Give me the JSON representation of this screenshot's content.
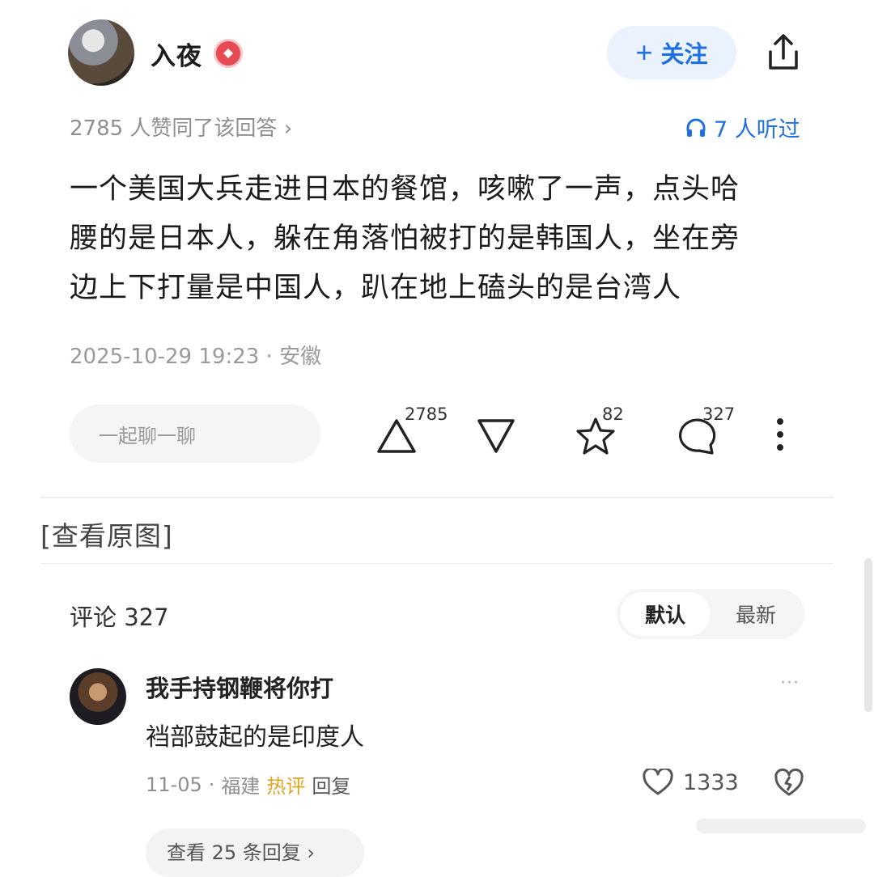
{
  "author": {
    "name": "入夜",
    "follow_label": "关注",
    "follow_plus": "+"
  },
  "meta": {
    "likes_text": "2785 人赞同了该回答 ›",
    "listeners_text": "7 人听过"
  },
  "answer": {
    "lines": [
      "一个美国大兵走进日本的餐馆，咳嗽了一声，点头哈",
      "腰的是日本人，躲在角落怕被打的是韩国人，坐在旁",
      "边上下打量是中国人，趴在地上磕头的是台湾人"
    ],
    "timestamp": "2025-10-29 19:23 · 安徽"
  },
  "actions": {
    "chat_placeholder": "一起聊一聊",
    "upvote_count": "2785",
    "favorite_count": "82",
    "comment_count": "327"
  },
  "view_original": "[查看原图]",
  "comments": {
    "title": "评论 327",
    "sort_default": "默认",
    "sort_latest": "最新",
    "items": [
      {
        "user": "我手持钢鞭将你打",
        "text": "裆部鼓起的是印度人",
        "date": "11-05",
        "location": "福建",
        "hot_label": "热评",
        "reply_label": "回复",
        "likes": "1333",
        "more": "···"
      }
    ],
    "view_replies": "查看 25 条回复 ›"
  },
  "colors": {
    "accent": "#1e6fe0",
    "hot": "#e0a322",
    "badge": "#e64a52"
  },
  "icons": [
    "share-icon",
    "headphone-icon",
    "upvote-icon",
    "downvote-icon",
    "star-icon",
    "comment-icon",
    "more-icon",
    "heart-icon",
    "dislike-icon"
  ]
}
